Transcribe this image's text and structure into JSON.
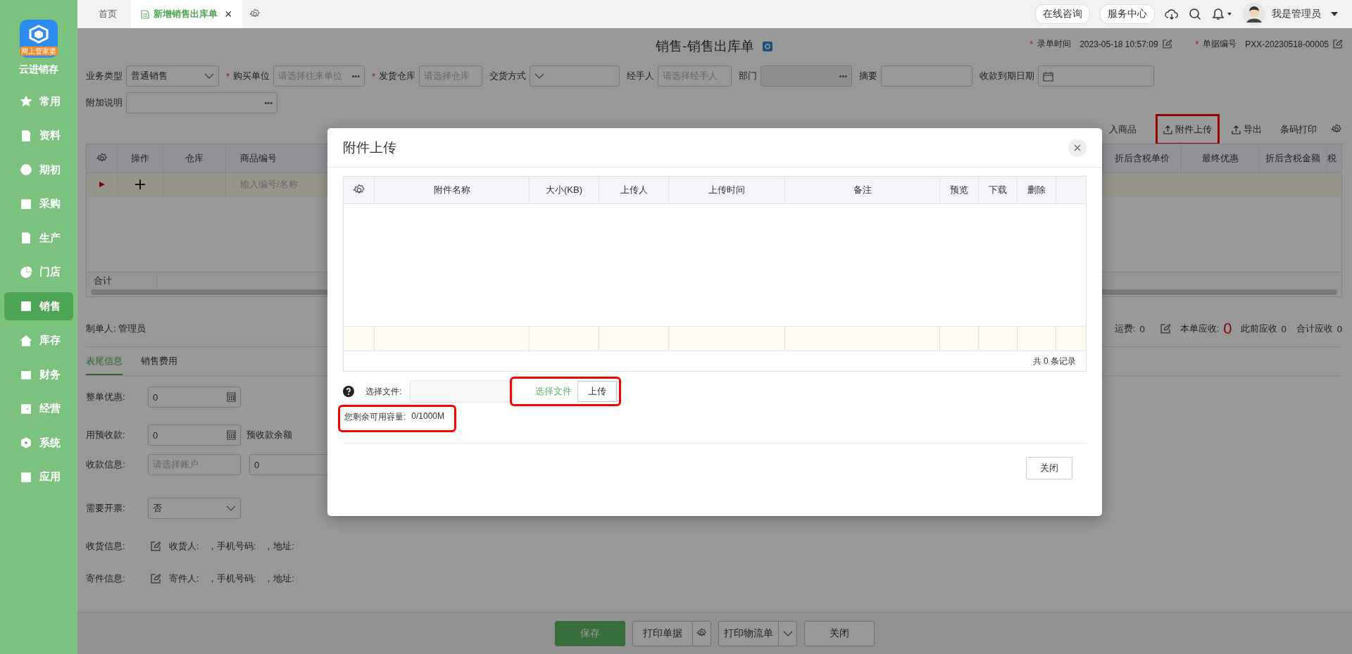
{
  "sidebar": {
    "logo_badge": "网上管家婆",
    "logo_text": "云进销存",
    "items": [
      {
        "label": "常用",
        "selected": false
      },
      {
        "label": "资料",
        "selected": false
      },
      {
        "label": "期初",
        "selected": false
      },
      {
        "label": "采购",
        "selected": false
      },
      {
        "label": "生产",
        "selected": false
      },
      {
        "label": "门店",
        "selected": false
      },
      {
        "label": "销售",
        "selected": true
      },
      {
        "label": "库存",
        "selected": false
      },
      {
        "label": "财务",
        "selected": false
      },
      {
        "label": "经营",
        "selected": false
      },
      {
        "label": "系统",
        "selected": false
      },
      {
        "label": "应用",
        "selected": false
      }
    ]
  },
  "topbar": {
    "tabs": [
      {
        "label": "首页",
        "selected": false
      },
      {
        "label": "新增销售出库单",
        "selected": true,
        "close": "×"
      }
    ],
    "buttons": [
      "在线咨询",
      "服务中心"
    ],
    "user": "我是管理员"
  },
  "page": {
    "title": "销售-销售出库单",
    "meta": [
      {
        "required_mark": "*",
        "label": "录单时间",
        "value": "2023-05-18 10:57:09"
      },
      {
        "required_mark": "*",
        "label": "单据编号",
        "value": "PXX-20230518-00005"
      }
    ],
    "fields": [
      {
        "label": "业务类型",
        "kind": "select",
        "value": "普通销售"
      },
      {
        "required_mark": "*",
        "label": "购买单位",
        "kind": "lookup",
        "placeholder": "请选择往来单位",
        "more": "•••"
      },
      {
        "required_mark": "*",
        "label": "发货仓库",
        "kind": "text",
        "placeholder": "请选择仓库"
      },
      {
        "label": "交货方式",
        "kind": "select"
      },
      {
        "label": "经手人",
        "kind": "text",
        "placeholder": "请选择经手人"
      },
      {
        "label": "部门",
        "kind": "disabled",
        "more": "•••"
      },
      {
        "label": "摘要",
        "kind": "text"
      },
      {
        "label": "收款到期日期",
        "kind": "date"
      },
      {
        "label": "附加说明",
        "kind": "lookup",
        "more": "•••"
      }
    ],
    "toolbar": [
      {
        "label": "入商品",
        "highlighted": false,
        "icon": false
      },
      {
        "label": "附件上传",
        "highlighted": true,
        "icon": true
      },
      {
        "label": "导出",
        "highlighted": false,
        "icon": true
      },
      {
        "label": "条码打印",
        "highlighted": false,
        "icon": false
      }
    ],
    "grid": {
      "left_columns": [
        "操作",
        "仓库",
        "商品编号"
      ],
      "right_columns": [
        "折后含税单价",
        "最终优惠",
        "折后含税金额",
        "税"
      ],
      "row_placeholder": "输入编号/名称",
      "total_label": "合计"
    },
    "maker": "制单人: 管理员",
    "summary": [
      {
        "label": "运费:",
        "value": "0",
        "kind": "plain"
      },
      {
        "label": "本单应收:",
        "value": "0",
        "kind": "alert"
      },
      {
        "label": "此前应收",
        "value": "0",
        "kind": "plain"
      },
      {
        "label": "合计应收",
        "value": "0",
        "kind": "plain"
      }
    ],
    "tabs": [
      {
        "label": "表尾信息",
        "selected": true
      },
      {
        "label": "销售费用",
        "selected": false
      }
    ],
    "footer_fields": [
      {
        "label": "整单优惠:",
        "kind": "calc",
        "value": "0"
      },
      {
        "label": "用预收款:",
        "kind": "calc",
        "value": "0",
        "note": "预收款余额"
      },
      {
        "label": "收款信息:",
        "kind": "account",
        "placeholder": "请选择账户",
        "value": "0"
      },
      {
        "label": "需要开票:",
        "kind": "select",
        "value": "否"
      },
      {
        "label": "收货信息:",
        "kind": "info",
        "parts": [
          "收货人:",
          "，手机号码:",
          "，地址:"
        ]
      },
      {
        "label": "寄件信息:",
        "kind": "info",
        "parts": [
          "寄件人:",
          "，手机号码:",
          "，地址:"
        ]
      }
    ],
    "actions": [
      {
        "label": "保存",
        "kind": "primary"
      },
      {
        "label": "打印单据",
        "kind": "gear"
      },
      {
        "label": "打印物流单",
        "kind": "dropdown"
      },
      {
        "label": "关闭",
        "kind": "plain"
      }
    ]
  },
  "dialog": {
    "title": "附件上传",
    "columns": [
      "附件名称",
      "大小(KB)",
      "上传人",
      "上传时间",
      "备注",
      "预览",
      "下载",
      "删除"
    ],
    "pager": "共 0 条记录",
    "file_label": "选择文件:",
    "file_actions": {
      "highlighted": true,
      "choose": "选择文件",
      "upload": "上传"
    },
    "capacity": {
      "highlighted": true,
      "label": "您剩余可用容量:",
      "value": "0/1000M"
    },
    "close_button": "关闭"
  }
}
